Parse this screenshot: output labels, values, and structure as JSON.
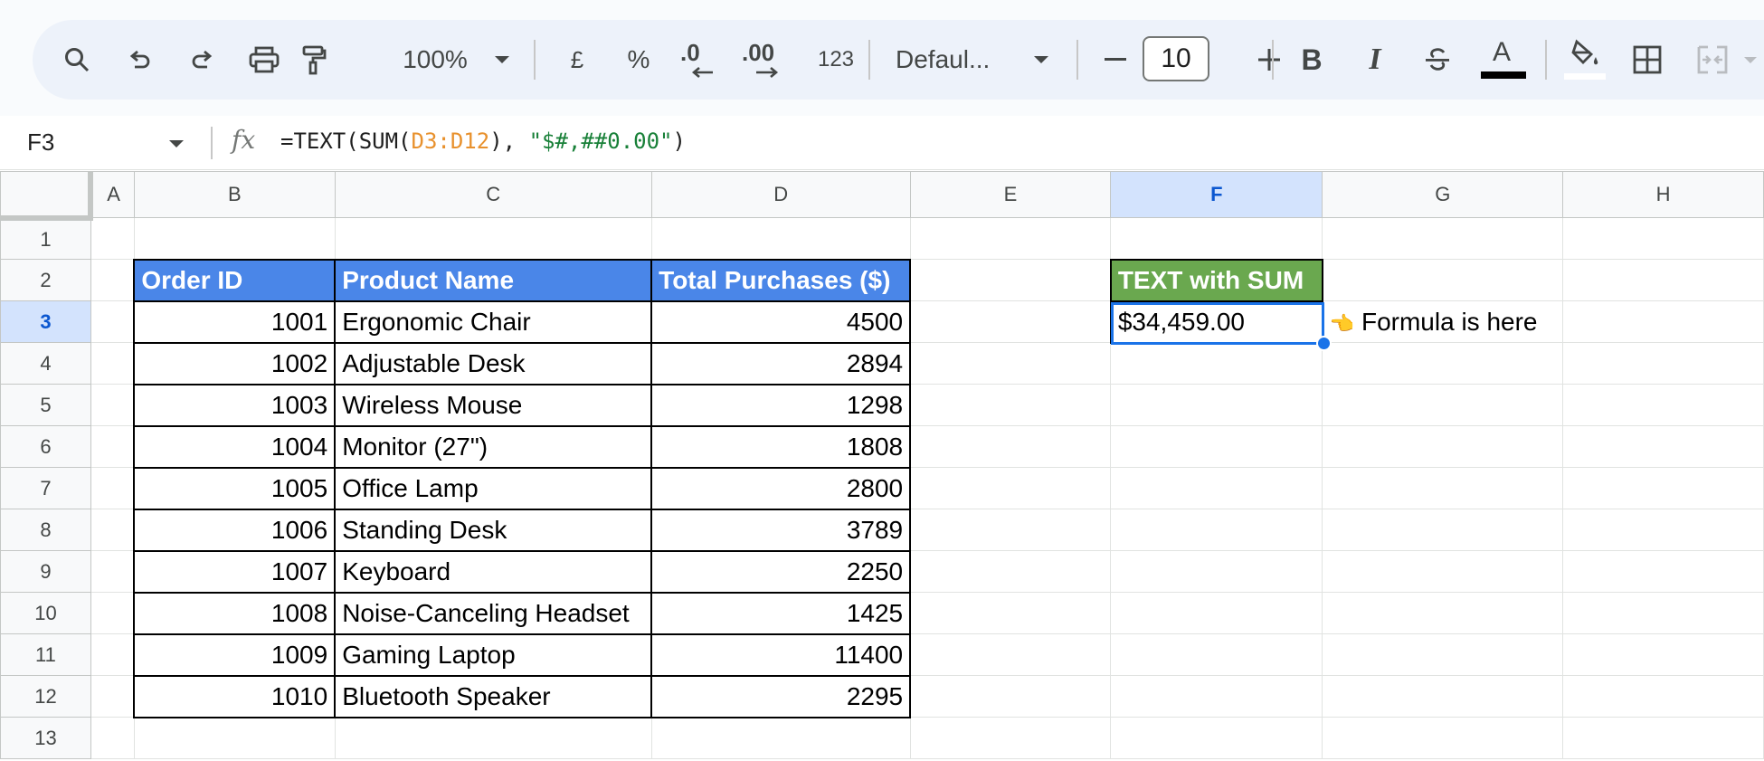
{
  "toolbar": {
    "zoom": "100%",
    "currency": "£",
    "percent": "%",
    "decrease_decimal": ".0",
    "increase_decimal": ".00",
    "more_formats": "123",
    "font": "Defaul...",
    "font_size": "10",
    "bold": "B",
    "italic": "I",
    "text_color_letter": "A",
    "icons": [
      "search-icon",
      "undo-icon",
      "redo-icon",
      "print-icon",
      "paint-format-icon",
      "chevron-down-icon",
      "decrease-decimal-arrow-icon",
      "increase-decimal-arrow-icon",
      "minus-icon",
      "plus-icon",
      "strikethrough-icon",
      "text-color-icon",
      "fill-color-icon",
      "borders-icon",
      "merge-cells-icon"
    ],
    "text_color_bar": "#000000"
  },
  "formula_bar": {
    "cell_ref": "F3",
    "fx": "fx",
    "formula_prefix": "=TEXT(SUM(",
    "formula_range": "D3:D12",
    "formula_mid": "), ",
    "formula_string": "\"$#,##0.00\"",
    "formula_suffix": ")"
  },
  "sheet": {
    "columns": [
      "A",
      "B",
      "C",
      "D",
      "E",
      "F",
      "G",
      "H"
    ],
    "selected_column": "F",
    "selected_row": 3,
    "rows": [
      "1",
      "2",
      "3",
      "4",
      "5",
      "6",
      "7",
      "8",
      "9",
      "10",
      "11",
      "12",
      "13"
    ],
    "headers": {
      "order_id": "Order ID",
      "product_name": "Product Name",
      "total_purchases": "Total Purchases ($)",
      "text_with_sum": "TEXT with SUM"
    },
    "orders": [
      {
        "id": "1001",
        "product": "Ergonomic Chair",
        "total": "4500"
      },
      {
        "id": "1002",
        "product": "Adjustable Desk",
        "total": "2894"
      },
      {
        "id": "1003",
        "product": "Wireless Mouse",
        "total": "1298"
      },
      {
        "id": "1004",
        "product": "Monitor (27\")",
        "total": "1808"
      },
      {
        "id": "1005",
        "product": "Office Lamp",
        "total": "2800"
      },
      {
        "id": "1006",
        "product": "Standing Desk",
        "total": "3789"
      },
      {
        "id": "1007",
        "product": "Keyboard",
        "total": "2250"
      },
      {
        "id": "1008",
        "product": "Noise-Canceling Headset",
        "total": "1425"
      },
      {
        "id": "1009",
        "product": "Gaming Laptop",
        "total": "11400"
      },
      {
        "id": "1010",
        "product": "Bluetooth Speaker",
        "total": "2295"
      }
    ],
    "result": "$34,459.00",
    "note_icon": "👈",
    "note_text": "Formula is here"
  },
  "colors": {
    "header_blue": "#4a86e8",
    "header_green": "#6aa84f",
    "selection": "#1a73e8",
    "range_orange": "#e8912d",
    "string_green": "#188038"
  }
}
